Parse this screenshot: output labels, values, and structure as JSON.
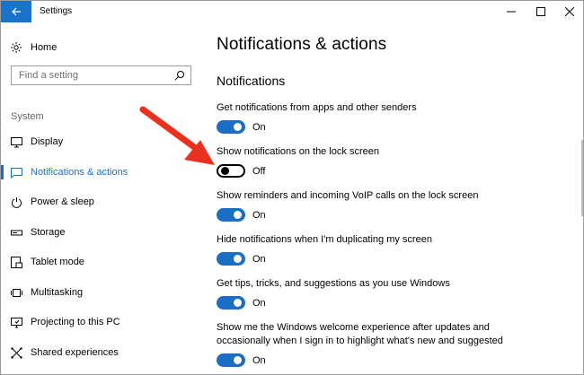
{
  "window": {
    "title": "Settings"
  },
  "sidebar": {
    "home_label": "Home",
    "search_placeholder": "Find a setting",
    "section_label": "System",
    "items": [
      {
        "label": "Display",
        "icon": "display-icon"
      },
      {
        "label": "Notifications & actions",
        "icon": "notifications-icon",
        "active": true
      },
      {
        "label": "Power & sleep",
        "icon": "power-icon"
      },
      {
        "label": "Storage",
        "icon": "storage-icon"
      },
      {
        "label": "Tablet mode",
        "icon": "tablet-mode-icon"
      },
      {
        "label": "Multitasking",
        "icon": "multitasking-icon"
      },
      {
        "label": "Projecting to this PC",
        "icon": "projecting-icon"
      },
      {
        "label": "Shared experiences",
        "icon": "shared-experiences-icon"
      }
    ]
  },
  "main": {
    "page_title": "Notifications & actions",
    "section_title": "Notifications",
    "settings": [
      {
        "description": "Get notifications from apps and other senders",
        "state": "On"
      },
      {
        "description": "Show notifications on the lock screen",
        "state": "Off"
      },
      {
        "description": "Show reminders and incoming VoIP calls on the lock screen",
        "state": "On"
      },
      {
        "description": "Hide notifications when I'm duplicating my screen",
        "state": "On"
      },
      {
        "description": "Get tips, tricks, and suggestions as you use Windows",
        "state": "On"
      },
      {
        "description": "Show me the Windows welcome experience after updates and occasionally when I sign in to highlight what's new and suggested",
        "state": "On"
      }
    ]
  },
  "colors": {
    "accent": "#1a6fc4",
    "annotation_arrow": "#e8321f"
  }
}
